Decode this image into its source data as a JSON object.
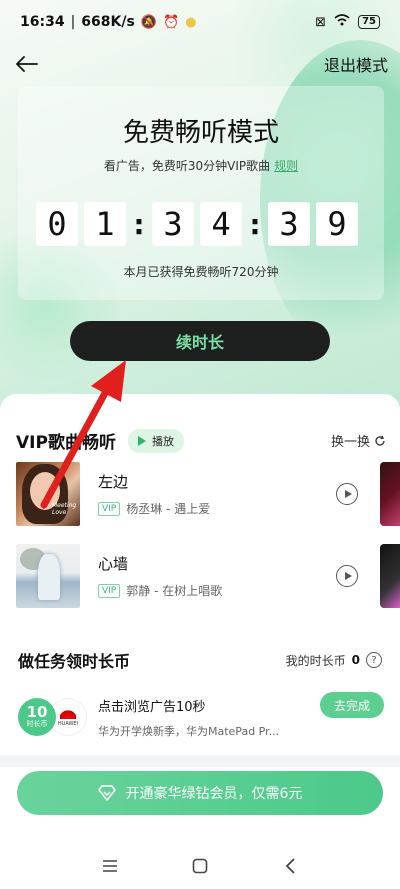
{
  "status_bar": {
    "time": "16:34",
    "speed": "668K/s",
    "battery": "75"
  },
  "header": {
    "exit_label": "退出模式"
  },
  "mode_card": {
    "title": "免费畅听模式",
    "subtitle": "看广告，免费听30分钟VIP歌曲",
    "rules_link": "规则",
    "timer_digits": [
      "0",
      "1",
      "3",
      "4",
      "3",
      "9"
    ],
    "monthly_note": "本月已获得免费畅听720分钟"
  },
  "extend_button": "续时长",
  "vip_section": {
    "title": "VIP歌曲畅听",
    "play_label": "播放",
    "refresh_label": "换一换",
    "songs": [
      {
        "name": "左边",
        "badge": "VIP",
        "meta": "杨丞琳 - 遇上爱",
        "cover_text": "Meeting Love"
      },
      {
        "name": "心墙",
        "badge": "VIP",
        "meta": "郭静 - 在树上唱歌",
        "cover_text": ""
      }
    ]
  },
  "task_section": {
    "title": "做任务领时长币",
    "coins_label": "我的时长币",
    "coins_value": "0",
    "help_icon": "?",
    "task": {
      "coin_amount": "10",
      "coin_unit": "时长币",
      "brand": "HUAWEI",
      "name": "点击浏览广告10秒",
      "desc": "华为开学焕新季，华为MatePad Pr...",
      "action": "去完成"
    }
  },
  "vip_bar": {
    "label": "开通豪华绿钻会员，仅需6元"
  },
  "colors": {
    "accent_green": "#4cc98a",
    "dark_button": "#1e1f1f",
    "annotation_arrow": "#e0201c"
  }
}
